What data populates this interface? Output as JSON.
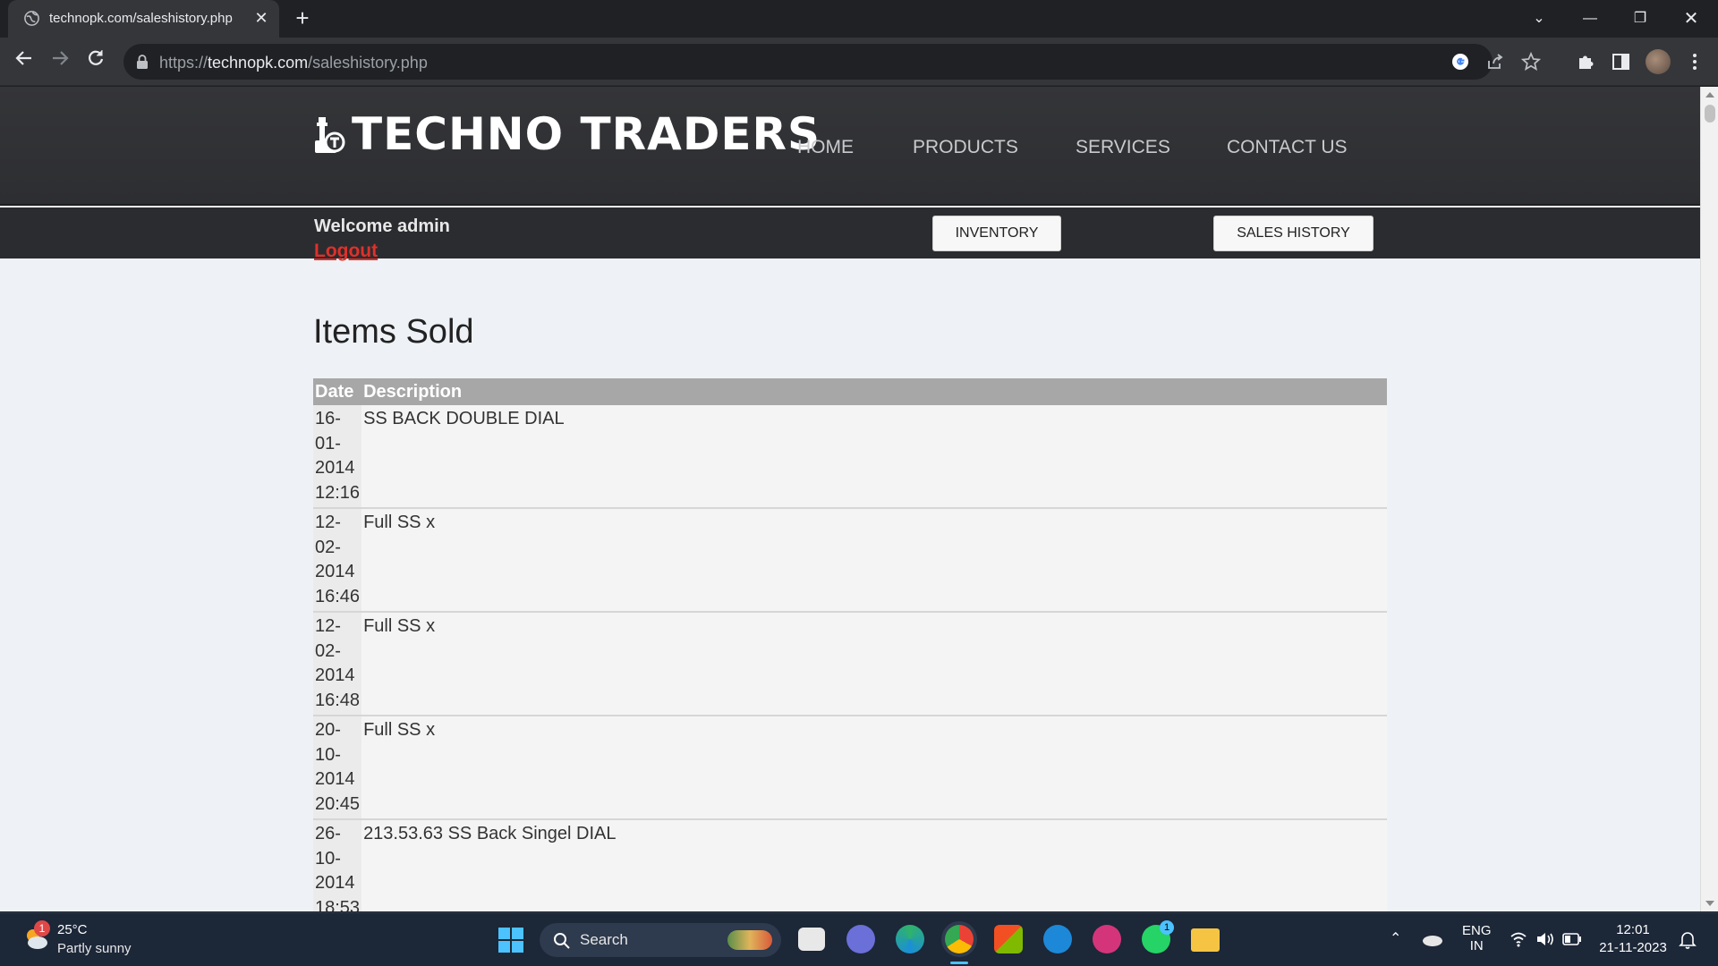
{
  "browser": {
    "tab_title": "technopk.com/saleshistory.php",
    "url_scheme": "https://",
    "url_host": "technopk.com",
    "url_path": "/saleshistory.php"
  },
  "site": {
    "logo_text": "TECHNO TRADERS",
    "nav": [
      "HOME",
      "PRODUCTS",
      "SERVICES",
      "CONTACT US"
    ],
    "welcome": "Welcome admin",
    "logout": "Logout",
    "buttons": {
      "inventory": "INVENTORY",
      "sales_history": "SALES HISTORY"
    },
    "page_title": "Items Sold",
    "table": {
      "headers": [
        "Date",
        "Description"
      ],
      "rows": [
        {
          "date_lines": [
            "16-",
            "01-",
            "2014",
            "12:16"
          ],
          "description": "SS BACK DOUBLE DIAL"
        },
        {
          "date_lines": [
            "12-",
            "02-",
            "2014",
            "16:46"
          ],
          "description": "Full SS x"
        },
        {
          "date_lines": [
            "12-",
            "02-",
            "2014",
            "16:48"
          ],
          "description": "Full SS x"
        },
        {
          "date_lines": [
            "20-",
            "10-",
            "2014",
            "20:45"
          ],
          "description": "Full SS x"
        },
        {
          "date_lines": [
            "26-",
            "10-",
            "2014",
            "18:53"
          ],
          "description": "213.53.63 SS Back Singel DIAL"
        }
      ]
    },
    "colors": {
      "header_bg": "#343538",
      "subbar_bg": "#2b2c2f",
      "logout": "#e0302a",
      "table_header": "#a7a7a7",
      "page_bg": "#eef1f6"
    }
  },
  "taskbar": {
    "weather_temp": "25°C",
    "weather_desc": "Partly sunny",
    "weather_badge": "1",
    "search_label": "Search",
    "lang_top": "ENG",
    "lang_bottom": "IN",
    "time": "12:01",
    "date": "21-11-2023",
    "whatsapp_badge": "1"
  }
}
